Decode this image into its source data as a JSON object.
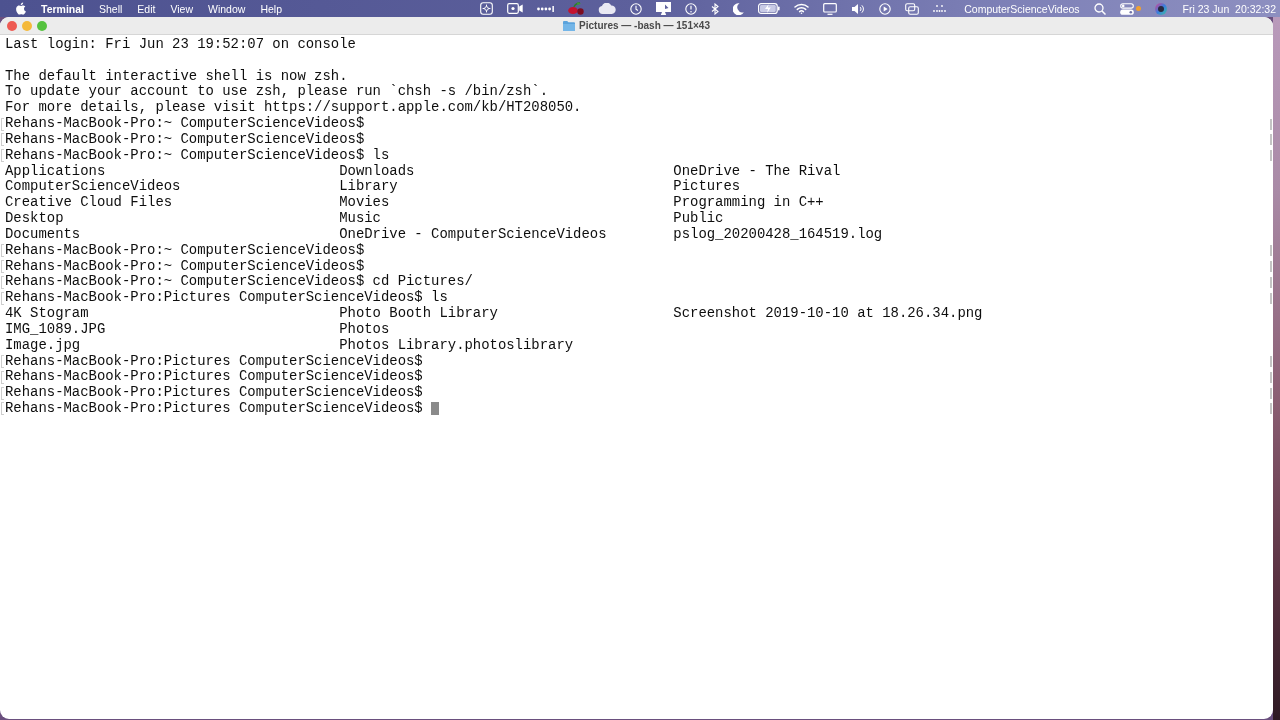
{
  "menu_bar": {
    "app_name": "Terminal",
    "menus": [
      "Shell",
      "Edit",
      "View",
      "Window",
      "Help"
    ],
    "user_name": "ComputerScienceVideos",
    "clock": "Fri 23 Jun  20:32:32"
  },
  "window": {
    "title": "Pictures — -bash — 151×43"
  },
  "terminal": {
    "lines": [
      {
        "kind": "text",
        "text": "Last login: Fri Jun 23 19:52:07 on console"
      },
      {
        "kind": "blank"
      },
      {
        "kind": "text",
        "text": "The default interactive shell is now zsh."
      },
      {
        "kind": "text",
        "text": "To update your account to use zsh, please run `chsh -s /bin/zsh`."
      },
      {
        "kind": "text",
        "text": "For more details, please visit https://support.apple.com/kb/HT208050."
      },
      {
        "kind": "prompt",
        "prompt": "Rehans-MacBook-Pro:~ ComputerScienceVideos$",
        "cursor": false
      },
      {
        "kind": "prompt",
        "prompt": "Rehans-MacBook-Pro:~ ComputerScienceVideos$",
        "cursor": false
      },
      {
        "kind": "prompt",
        "prompt": "Rehans-MacBook-Pro:~ ComputerScienceVideos$",
        "command": "ls",
        "cursor": false
      },
      {
        "kind": "listing",
        "cells": [
          "Applications",
          "Downloads",
          "OneDrive - The Rival"
        ]
      },
      {
        "kind": "listing",
        "cells": [
          "ComputerScienceVideos",
          "Library",
          "Pictures"
        ]
      },
      {
        "kind": "listing",
        "cells": [
          "Creative Cloud Files",
          "Movies",
          "Programming in C++"
        ]
      },
      {
        "kind": "listing",
        "cells": [
          "Desktop",
          "Music",
          "Public"
        ]
      },
      {
        "kind": "listing",
        "cells": [
          "Documents",
          "OneDrive - ComputerScienceVideos",
          "pslog_20200428_164519.log"
        ]
      },
      {
        "kind": "prompt",
        "prompt": "Rehans-MacBook-Pro:~ ComputerScienceVideos$",
        "cursor": false
      },
      {
        "kind": "prompt",
        "prompt": "Rehans-MacBook-Pro:~ ComputerScienceVideos$",
        "cursor": false
      },
      {
        "kind": "prompt",
        "prompt": "Rehans-MacBook-Pro:~ ComputerScienceVideos$",
        "command": "cd Pictures/",
        "cursor": false
      },
      {
        "kind": "prompt",
        "prompt": "Rehans-MacBook-Pro:Pictures ComputerScienceVideos$",
        "command": "ls",
        "cursor": false
      },
      {
        "kind": "listing",
        "cells": [
          "4K Stogram",
          "Photo Booth Library",
          "Screenshot 2019-10-10 at 18.26.34.png"
        ]
      },
      {
        "kind": "listing",
        "cells": [
          "IMG_1089.JPG",
          "Photos"
        ]
      },
      {
        "kind": "listing",
        "cells": [
          "Image.jpg",
          "Photos Library.photoslibrary"
        ]
      },
      {
        "kind": "prompt",
        "prompt": "Rehans-MacBook-Pro:Pictures ComputerScienceVideos$",
        "cursor": false
      },
      {
        "kind": "prompt",
        "prompt": "Rehans-MacBook-Pro:Pictures ComputerScienceVideos$",
        "cursor": false
      },
      {
        "kind": "prompt",
        "prompt": "Rehans-MacBook-Pro:Pictures ComputerScienceVideos$",
        "cursor": false
      },
      {
        "kind": "prompt",
        "prompt": "Rehans-MacBook-Pro:Pictures ComputerScienceVideos$",
        "cursor": true
      }
    ]
  }
}
